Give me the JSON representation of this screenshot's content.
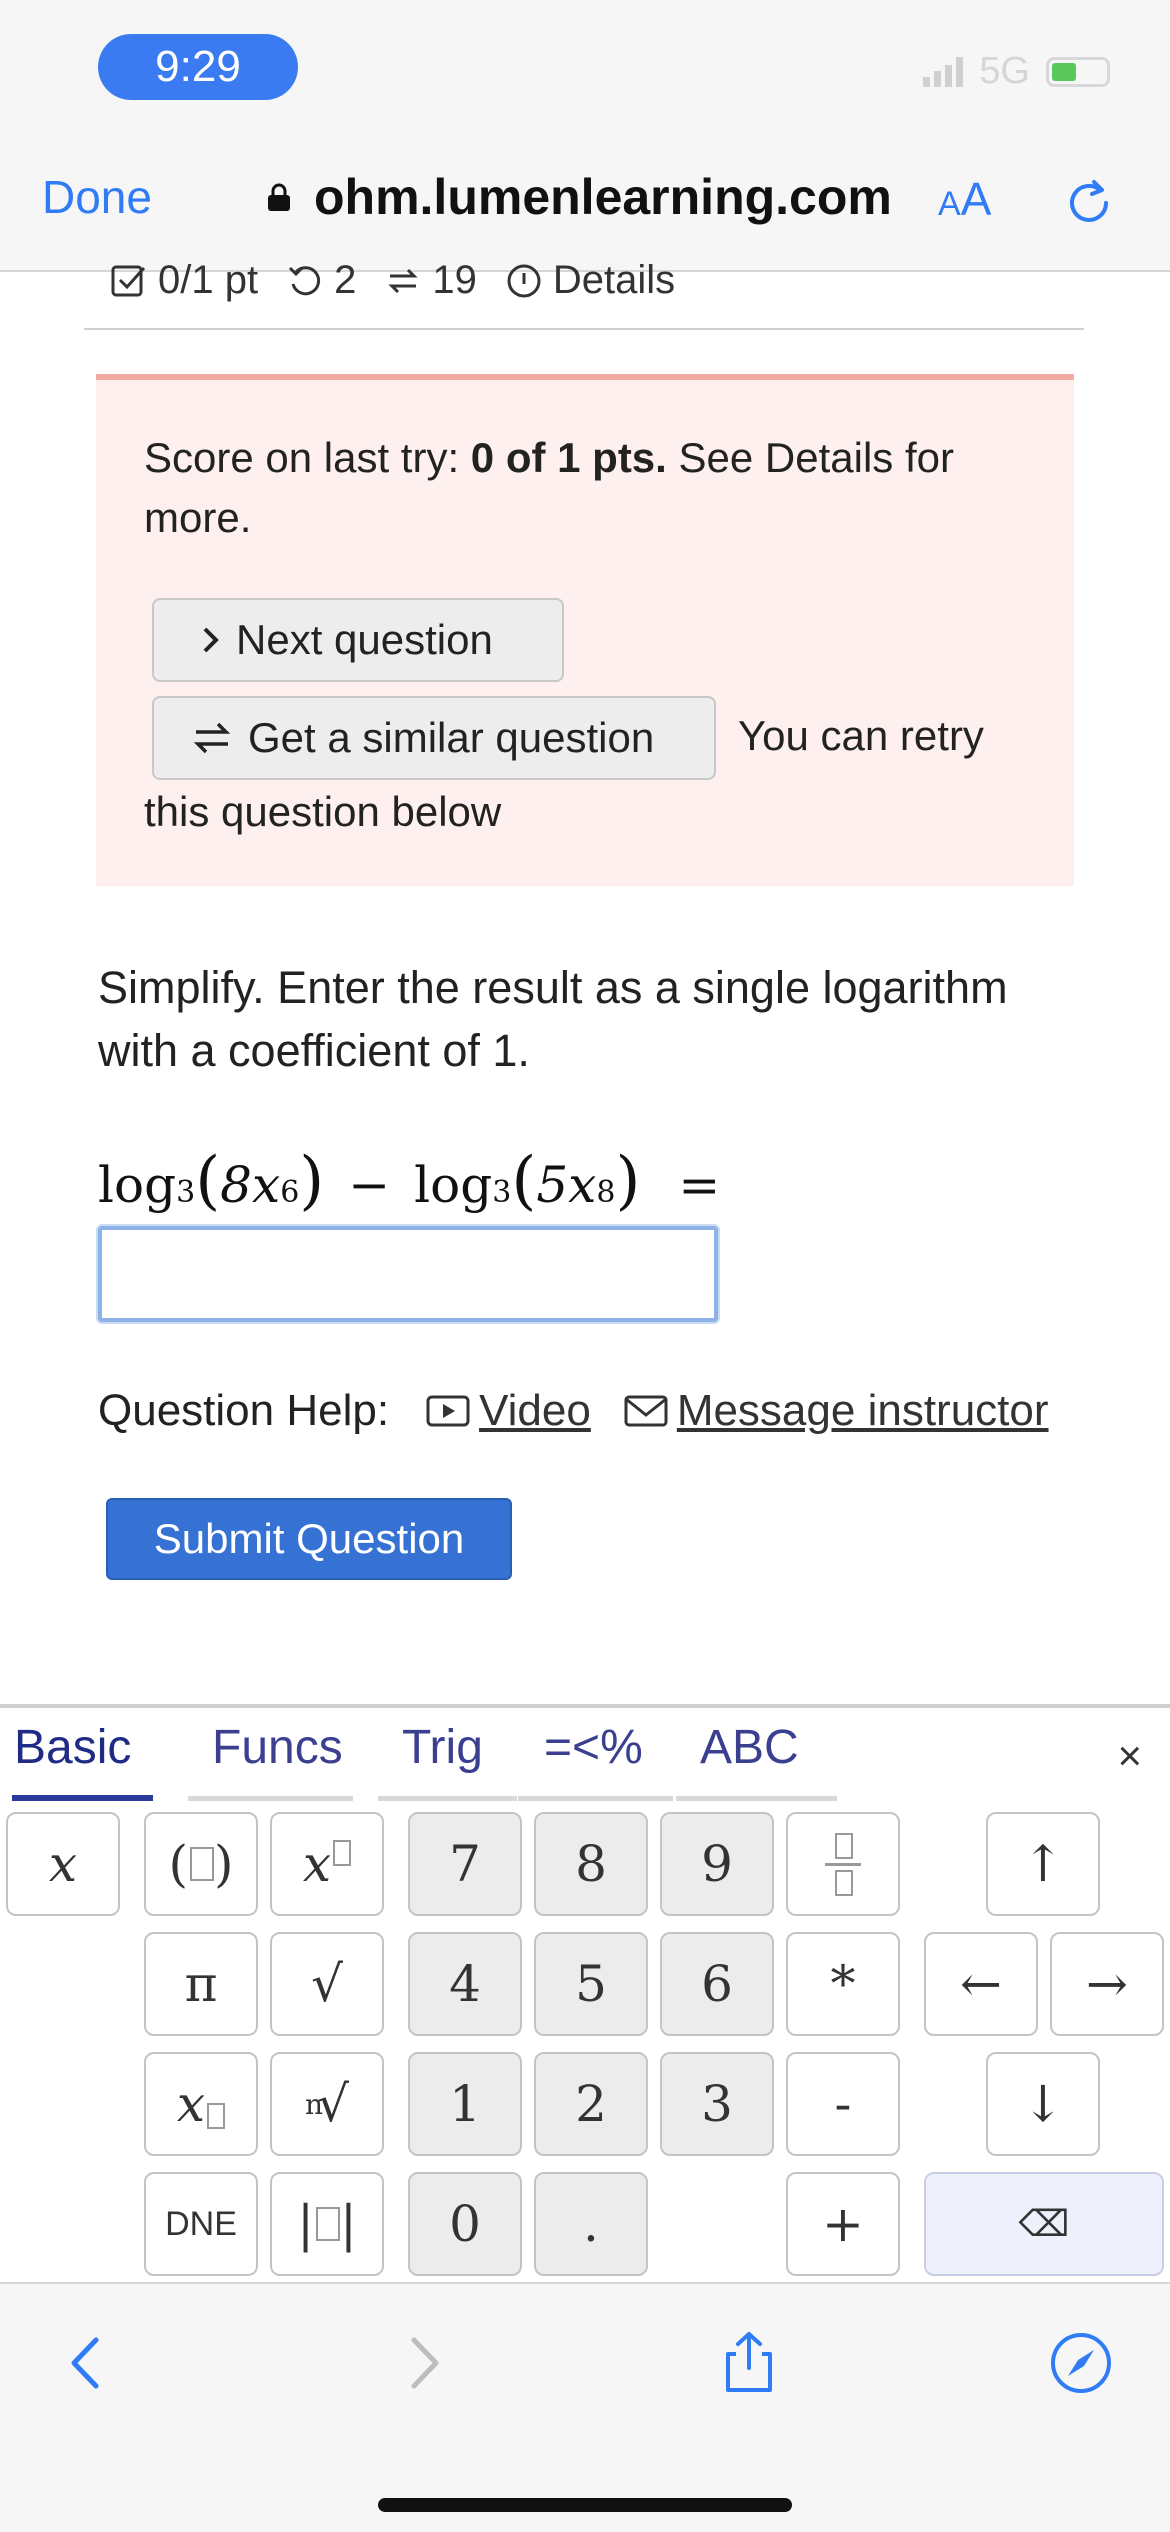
{
  "status": {
    "time": "9:29",
    "network": "5G"
  },
  "browser": {
    "done_label": "Done",
    "url": "ohm.lumenlearning.com",
    "aa_small": "A",
    "aa_large": "A"
  },
  "points_row": {
    "pts": "0/1 pt",
    "retries": "2",
    "similar": "19",
    "details": "Details"
  },
  "score_box": {
    "prefix": "Score on last try: ",
    "score": "0 of 1 pts.",
    "suffix": " See Details for more.",
    "next_label": "Next question",
    "similar_label": "Get a similar question",
    "retry_inline": "You can retry",
    "retry_rest": "this question below"
  },
  "question": {
    "prompt": "Simplify. Enter the result as a single logarithm with a coefficient of 1.",
    "math": {
      "log": "log",
      "base": "3",
      "open": "(",
      "close": ")",
      "term1_coef": "8x",
      "term1_exp": "6",
      "minus": "−",
      "term2_coef": "5x",
      "term2_exp": "8",
      "equals": "="
    },
    "answer_value": ""
  },
  "help": {
    "label": "Question Help:",
    "video": "Video",
    "message": "Message instructor"
  },
  "submit_label": "Submit Question",
  "keyboard": {
    "tabs": [
      "Basic",
      "Funcs",
      "Trig",
      "=<%",
      "ABC"
    ],
    "close": "×",
    "keys": {
      "x": "x",
      "pi": "π",
      "sqrt": "√",
      "nroot_n": "n",
      "dne": "DNE",
      "d7": "7",
      "d8": "8",
      "d9": "9",
      "d4": "4",
      "d5": "5",
      "d6": "6",
      "d1": "1",
      "d2": "2",
      "d3": "3",
      "d0": "0",
      "dot": ".",
      "times": "*",
      "minus": "-",
      "plus": "+",
      "up": "↑",
      "left": "←",
      "right": "→",
      "down": "↓",
      "backspace": "⌫"
    }
  },
  "icons": {
    "accent": "#2f7cf6",
    "submit_bg": "#3572d4"
  }
}
